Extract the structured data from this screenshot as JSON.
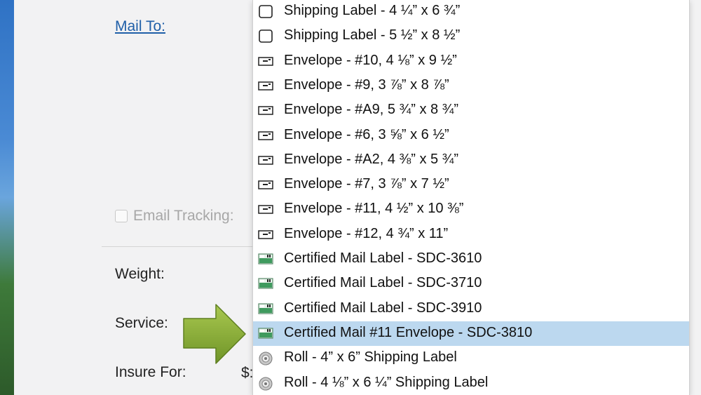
{
  "form": {
    "mail_to_label": "Mail To:",
    "email_tracking_label": "Email Tracking:",
    "weight_label": "Weight:",
    "service_label": "Service:",
    "insure_label": "Insure For:",
    "insure_currency": "$:"
  },
  "menu": {
    "items": [
      {
        "label": "Shipping Label - 4 ¼” x 6 ¾”",
        "icon": "shipping-label-icon"
      },
      {
        "label": "Shipping Label - 5 ½” x 8 ½”",
        "icon": "shipping-label-icon"
      },
      {
        "label": "Envelope - #10, 4 ⅛” x 9 ½”",
        "icon": "envelope-icon"
      },
      {
        "label": "Envelope - #9, 3 ⅞” x 8 ⅞”",
        "icon": "envelope-icon"
      },
      {
        "label": "Envelope - #A9, 5 ¾” x 8 ¾”",
        "icon": "envelope-icon"
      },
      {
        "label": "Envelope - #6, 3 ⅝” x 6 ½”",
        "icon": "envelope-icon"
      },
      {
        "label": "Envelope - #A2, 4 ⅜” x 5 ¾”",
        "icon": "envelope-icon"
      },
      {
        "label": "Envelope - #7, 3 ⅞” x 7 ½”",
        "icon": "envelope-icon"
      },
      {
        "label": "Envelope - #11, 4 ½” x 10 ⅜”",
        "icon": "envelope-icon"
      },
      {
        "label": "Envelope - #12, 4 ¾” x 11”",
        "icon": "envelope-icon"
      },
      {
        "label": "Certified Mail Label - SDC-3610",
        "icon": "certified-mail-icon"
      },
      {
        "label": "Certified Mail Label - SDC-3710",
        "icon": "certified-mail-icon"
      },
      {
        "label": "Certified Mail Label - SDC-3910",
        "icon": "certified-mail-icon"
      },
      {
        "label": "Certified Mail #11 Envelope - SDC-3810",
        "icon": "certified-mail-icon",
        "selected": true
      },
      {
        "label": "Roll - 4” x 6” Shipping Label",
        "icon": "roll-icon"
      },
      {
        "label": "Roll - 4 ⅛” x 6 ¼” Shipping Label",
        "icon": "roll-icon"
      }
    ]
  },
  "colors": {
    "selection": "#bcd8ef",
    "arrow": "#8db33a",
    "link": "#1f5fa8"
  }
}
